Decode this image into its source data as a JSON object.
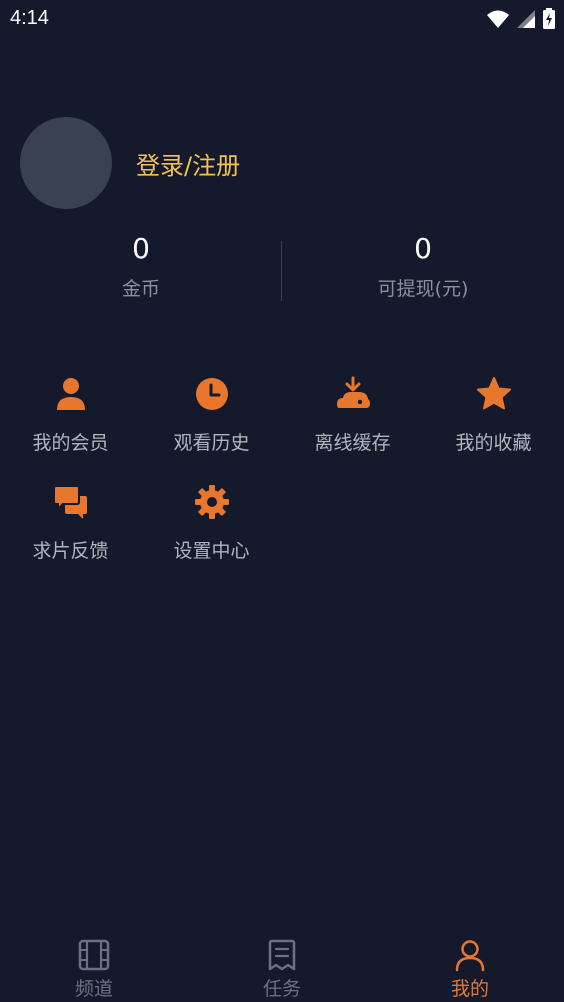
{
  "status_bar": {
    "time": "4:14"
  },
  "profile": {
    "login_label": "登录/注册"
  },
  "stats": {
    "coins": {
      "value": "0",
      "label": "金币"
    },
    "withdrawable": {
      "value": "0",
      "label": "可提现(元)"
    }
  },
  "menu": [
    {
      "label": "我的会员",
      "icon": "user-icon"
    },
    {
      "label": "观看历史",
      "icon": "clock-icon"
    },
    {
      "label": "离线缓存",
      "icon": "cloud-download-icon"
    },
    {
      "label": "我的收藏",
      "icon": "star-icon"
    },
    {
      "label": "求片反馈",
      "icon": "chat-icon"
    },
    {
      "label": "设置中心",
      "icon": "gear-icon"
    }
  ],
  "tabbar": {
    "tabs": [
      {
        "label": "频道",
        "icon": "film-icon",
        "active": false
      },
      {
        "label": "任务",
        "icon": "task-icon",
        "active": false
      },
      {
        "label": "我的",
        "icon": "person-icon",
        "active": true
      }
    ]
  },
  "colors": {
    "background": "#141a2c",
    "accent": "#e8772e",
    "login": "#f3c255",
    "inactive": "#6b7180"
  }
}
